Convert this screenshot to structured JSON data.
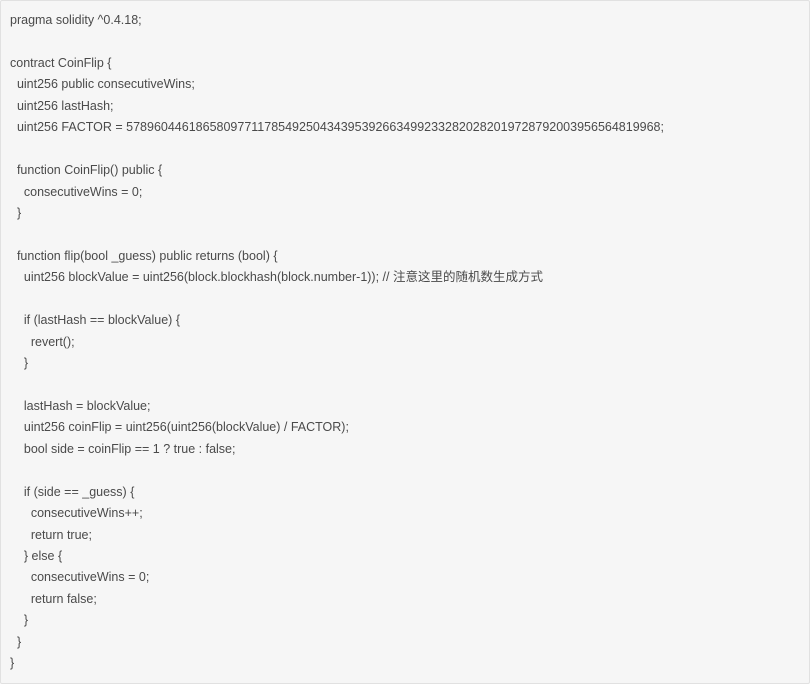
{
  "code": {
    "lines": [
      "pragma solidity ^0.4.18;",
      "",
      "contract CoinFlip {",
      "  uint256 public consecutiveWins;",
      "  uint256 lastHash;",
      "  uint256 FACTOR = 57896044618658097711785492504343953926634992332820282019728792003956564819968;",
      "",
      "  function CoinFlip() public {",
      "    consecutiveWins = 0;",
      "  }",
      "",
      "  function flip(bool _guess) public returns (bool) {",
      "    uint256 blockValue = uint256(block.blockhash(block.number-1)); // 注意这里的随机数生成方式",
      "",
      "    if (lastHash == blockValue) {",
      "      revert();",
      "    }",
      "",
      "    lastHash = blockValue;",
      "    uint256 coinFlip = uint256(uint256(blockValue) / FACTOR);",
      "    bool side = coinFlip == 1 ? true : false;",
      "",
      "    if (side == _guess) {",
      "      consecutiveWins++;",
      "      return true;",
      "    } else {",
      "      consecutiveWins = 0;",
      "      return false;",
      "    }",
      "  }",
      "}"
    ]
  }
}
